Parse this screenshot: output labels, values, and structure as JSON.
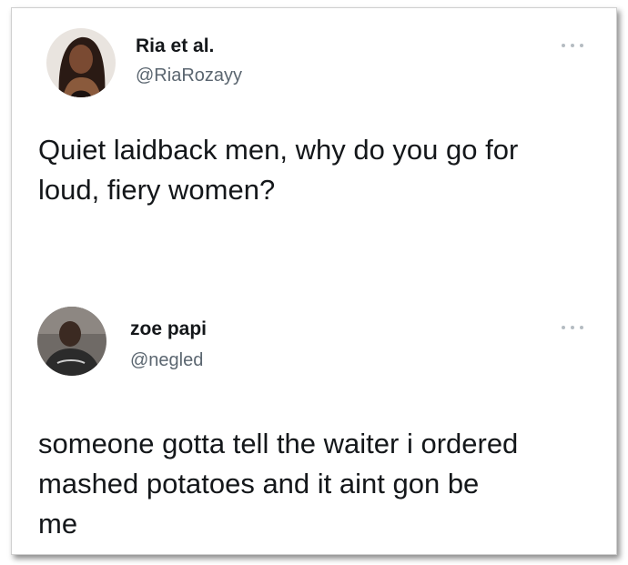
{
  "tweets": [
    {
      "name": "Ria et al.",
      "handle": "@RiaRozayy",
      "text_lines": [
        "Quiet laidback men, why do you go for",
        "loud, fiery women?"
      ],
      "more_icon": "more-horizontal-icon"
    },
    {
      "name": "zoe papi",
      "handle": "@negled",
      "text_lines": [
        "someone gotta tell the waiter i ordered",
        "mashed potatoes and it aint gon be",
        "me"
      ],
      "more_icon": "more-horizontal-icon"
    }
  ],
  "colors": {
    "name": "#14171a",
    "handle": "#5b6670",
    "text": "#14171a",
    "dots": "#b5bcc2",
    "background": "#ffffff"
  }
}
